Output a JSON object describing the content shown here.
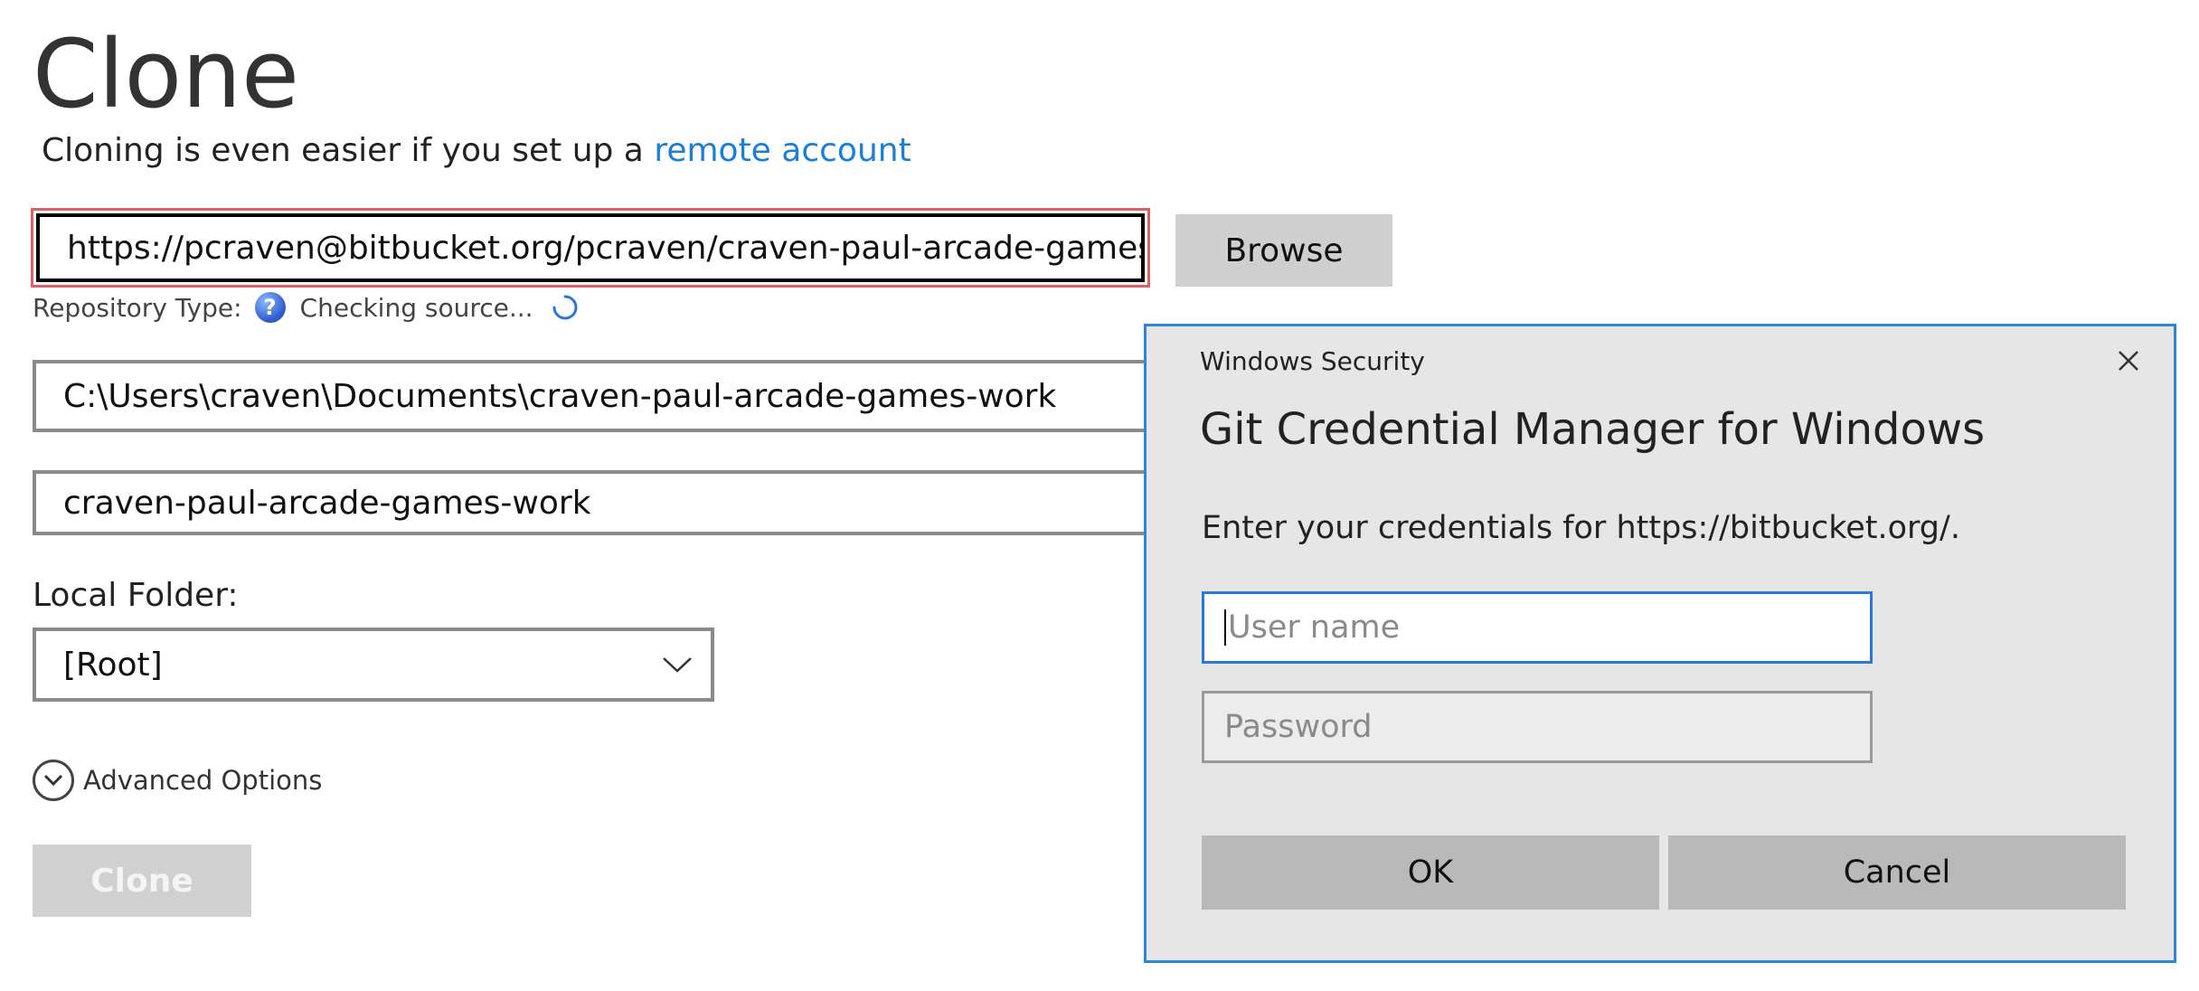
{
  "page": {
    "title": "Clone",
    "subtitle_text": "Cloning is even easier if you set up a ",
    "subtitle_link": "remote account"
  },
  "form": {
    "source_url": "https://pcraven@bitbucket.org/pcraven/craven-paul-arcade-games-wc",
    "browse_label": "Browse",
    "repo_type_label": "Repository Type:",
    "repo_status": "Checking source...",
    "destination_path": "C:\\Users\\craven\\Documents\\craven-paul-arcade-games-work",
    "repo_name": "craven-paul-arcade-games-work",
    "local_folder_label": "Local Folder:",
    "local_folder_value": "[Root]",
    "advanced_label": "Advanced Options",
    "clone_label": "Clone"
  },
  "dialog": {
    "caption": "Windows Security",
    "heading": "Git Credential Manager for Windows",
    "message": "Enter your credentials for https://bitbucket.org/.",
    "username_placeholder": "User name",
    "password_placeholder": "Password",
    "ok_label": "OK",
    "cancel_label": "Cancel"
  },
  "icons": {
    "help": "question-circle-icon",
    "spinner": "loading-spinner-icon",
    "dropdown": "chevron-down-icon",
    "expand": "chevron-circle-down-icon",
    "close": "close-icon"
  },
  "colors": {
    "link": "#1a7fd6",
    "focus_error_border": "#e06060",
    "dialog_border": "#2b88d8",
    "input_focus": "#2b78d8"
  }
}
